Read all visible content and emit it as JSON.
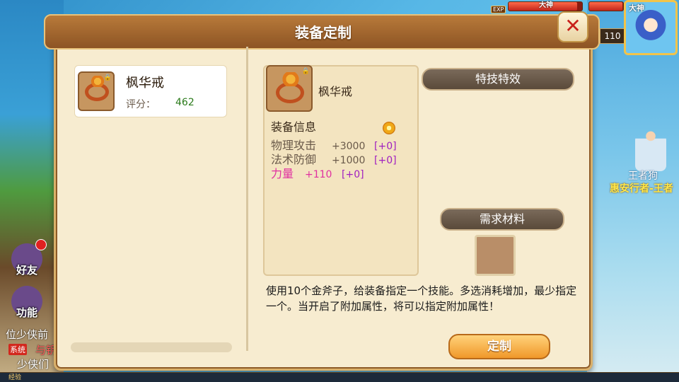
{
  "hud": {
    "exp_badge": "EXP",
    "target_tag": "大神",
    "player_tag": "大神",
    "level": "110",
    "target_hp": 0.93,
    "player_hp": 0.98
  },
  "npc": {
    "name": "王者狗",
    "title": "惠安行者-王者"
  },
  "side": {
    "friends_label": "好友",
    "function_label": "功能"
  },
  "chat": {
    "line1": "位少侠前",
    "system_tag": "系统",
    "system_text": "与钥",
    "line3": "少侠们"
  },
  "footer": {
    "exp_label": "经验"
  },
  "dialog": {
    "title": "装备定制",
    "close_glyph": "✕",
    "list": [
      {
        "name": "枫华戒",
        "score_label": "评分：",
        "score": "462"
      }
    ],
    "detail": {
      "name": "枫华戒",
      "section": "装备信息",
      "attrs": [
        {
          "name": "物理攻击",
          "value": "+3000",
          "bonus": "[+0]"
        },
        {
          "name": "法术防御",
          "value": "+1000",
          "bonus": "[+0]"
        },
        {
          "name": "力量",
          "value": "+110",
          "bonus": "[+0]"
        }
      ]
    },
    "effects_banner": "特技特效",
    "materials_banner": "需求材料",
    "description": "使用10个金斧子，给装备指定一个技能。多选消耗增加，最少指定一个。当开启了附加属性，将可以指定附加属性！",
    "action_button": "定制"
  },
  "colors": {
    "accent_gold": "#f0982a",
    "bonus_purple": "#a020c0",
    "special_pink": "#e030a0",
    "score_green": "#2a7a1a"
  }
}
